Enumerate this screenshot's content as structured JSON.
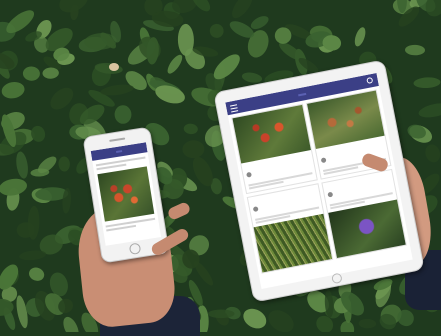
{
  "scene": {
    "background": "hedge",
    "colors": {
      "foliage_dark": "#1f3a1e",
      "foliage_light": "#4f7a3a",
      "app_header": "#3b3f86"
    }
  },
  "devices": {
    "tablet": {
      "kind": "ipad",
      "app_header_color": "#3b3f86"
    },
    "phone": {
      "kind": "iphone",
      "app_header_color": "#3b3f86"
    }
  }
}
